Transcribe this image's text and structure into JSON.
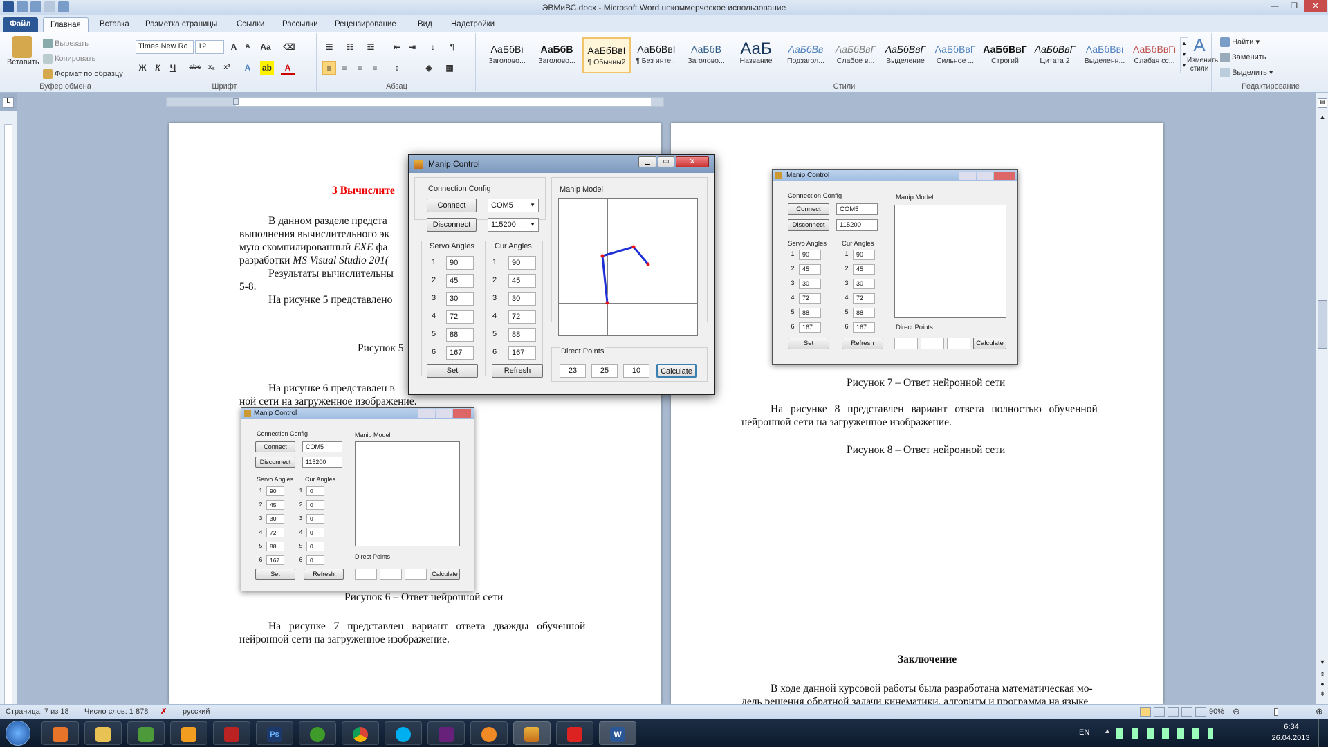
{
  "window": {
    "title": "ЭВМиВС.docx - Microsoft Word некоммерческое использование"
  },
  "tabs": [
    "Файл",
    "Главная",
    "Вставка",
    "Разметка страницы",
    "Ссылки",
    "Рассылки",
    "Рецензирование",
    "Вид",
    "Надстройки"
  ],
  "ribbon": {
    "clipboard": {
      "paste": "Вставить",
      "cut": "Вырезать",
      "copy": "Копировать",
      "format": "Формат по образцу",
      "label": "Буфер обмена"
    },
    "font": {
      "name": "Times New Rc",
      "size": "12",
      "label": "Шрифт"
    },
    "paragraph": {
      "label": "Абзац"
    },
    "styles": {
      "items": [
        {
          "sample": "АаБбВі",
          "name": "Заголово...",
          "color": "#111111"
        },
        {
          "sample": "АаБбВ",
          "name": "Заголово...",
          "color": "#111111"
        },
        {
          "sample": "АаБбВвІ",
          "name": "¶ Обычный",
          "color": "#111111"
        },
        {
          "sample": "АаБбВвІ",
          "name": "¶ Без инте...",
          "color": "#111111"
        },
        {
          "sample": "АаБбВ",
          "name": "Заголово...",
          "color": "#2e5c8a"
        },
        {
          "sample": "АаБ",
          "name": "Название",
          "color": "#17365d"
        },
        {
          "sample": "АаБбВв",
          "name": "Подзагол...",
          "color": "#4f81bd"
        },
        {
          "sample": "АаБбВвГ",
          "name": "Слабое в...",
          "color": "#808080"
        },
        {
          "sample": "АаБбВвГ",
          "name": "Выделение",
          "color": "#111111"
        },
        {
          "sample": "АаБбВвГ",
          "name": "Сильное ...",
          "color": "#4f81bd"
        },
        {
          "sample": "АаБбВвГ",
          "name": "Строгий",
          "color": "#111111"
        },
        {
          "sample": "АаБбВвГ",
          "name": "Цитата 2",
          "color": "#111111"
        },
        {
          "sample": "АаБбВві",
          "name": "Выделенн...",
          "color": "#4f81bd"
        },
        {
          "sample": "АаБбВвГі",
          "name": "Слабая сс...",
          "color": "#c0504d"
        }
      ],
      "change": "Изменить стили",
      "label": "Стили"
    },
    "editing": {
      "find": "Найти",
      "replace": "Заменить",
      "select": "Выделить",
      "label": "Редактирование"
    }
  },
  "page1": {
    "heading": "3 Вычислите",
    "p1a": "В данном разделе предста",
    "p1b": "выполнения вычислительного эк",
    "p1c": "мую скомпилированный",
    "p1c_exe": "EXE",
    "p1c_tail": "фа",
    "p1d": "разработки",
    "p1d_it": "MS Visual Studio 201(",
    "p2a": "Результаты вычислительны",
    "p2b": "5-8.",
    "p3": "На рисунке 5 представлено",
    "cap5": "Рисунок 5",
    "p4a": "На рисунке 6 представлен в",
    "p4b": "ной сети на загруженное изображение.",
    "cap6": "Рисунок 6 – Ответ нейронной сети",
    "p5a": "На рисунке 7 представлен вариант ответа дважды обученной",
    "p5b": "нейронной сети на загруженное изображение."
  },
  "page2": {
    "cap7": "Рисунок 7 – Ответ нейронной сети",
    "p1a": "На рисунке 8 представлен вариант ответа полностью обученной",
    "p1b": "нейронной сети на загруженное изображение.",
    "cap8": "Рисунок 8 – Ответ нейронной сети",
    "concl": "Заключение",
    "c1": "В ходе данной курсовой работы была разработана математическая мо-",
    "c2": "дель решения обратной задачи кинематики, алгоритм и программа на языке"
  },
  "app": {
    "title": "Manip Control",
    "connection": "Connection Config",
    "connect": "Connect",
    "disconnect": "Disconnect",
    "port": "COM5",
    "baud": "115200",
    "servo": "Servo Angles",
    "cur": "Cur Angles",
    "model": "Manip Model",
    "direct": "Direct Points",
    "set": "Set",
    "refresh": "Refresh",
    "calculate": "Calculate",
    "indices": [
      "1",
      "2",
      "3",
      "4",
      "5",
      "6"
    ],
    "servo_values": [
      "90",
      "45",
      "30",
      "72",
      "88",
      "167"
    ],
    "cur_values": [
      "90",
      "45",
      "30",
      "72",
      "88",
      "167"
    ],
    "cur_zero": [
      "0",
      "0",
      "0",
      "0",
      "0",
      "0"
    ],
    "points": [
      "23",
      "25",
      "10"
    ]
  },
  "status": {
    "page": "Страница: 7 из 18",
    "words": "Число слов: 1 878",
    "lang": "русский",
    "zoom": "90%"
  },
  "taskbar": {
    "lang": "EN",
    "time": "6:34",
    "date": "26.04.2013"
  }
}
